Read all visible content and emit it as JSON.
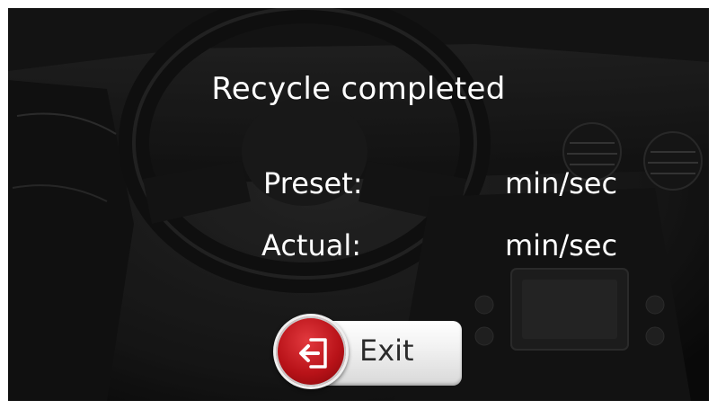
{
  "dialog": {
    "title": "Recycle completed",
    "preset_label": "Preset:",
    "preset_unit": "min/sec",
    "actual_label": "Actual:",
    "actual_unit": "min/sec"
  },
  "exit_button": {
    "label": "Exit",
    "icon": "exit-door-icon"
  },
  "colors": {
    "overlay_text": "#ffffff",
    "exit_circle": "#c0171d",
    "exit_pill": "#f0f0f0"
  }
}
